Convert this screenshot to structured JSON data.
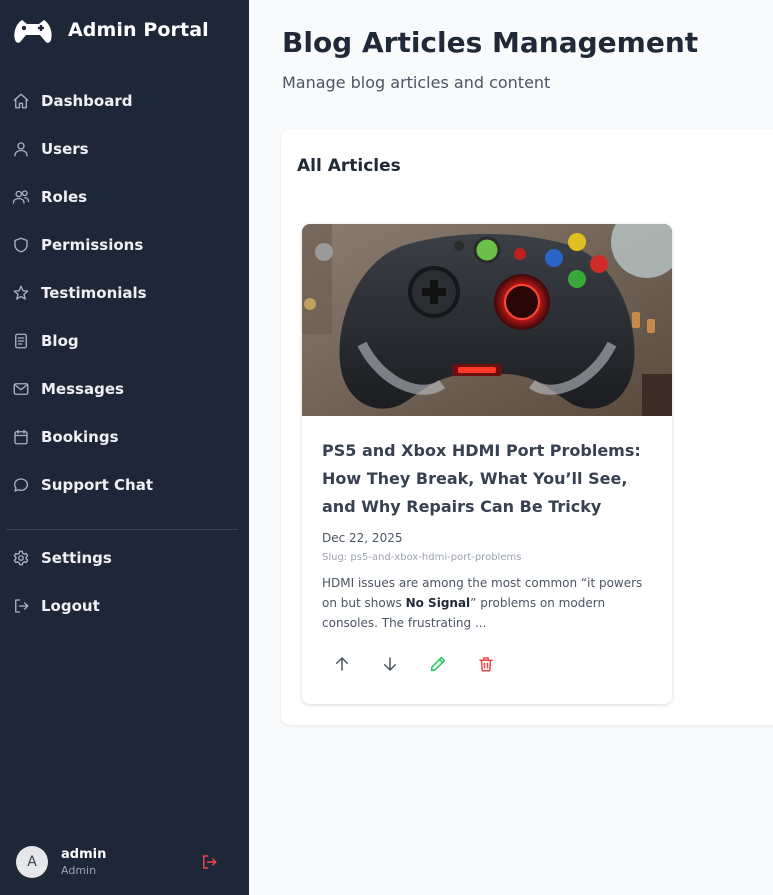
{
  "app": {
    "title": "Admin Portal"
  },
  "colors": {
    "sidebar_bg": "#1e2738",
    "accent_green": "#22c55e",
    "danger": "#ef4444"
  },
  "nav": {
    "items": [
      {
        "label": "Dashboard",
        "icon": "home-icon"
      },
      {
        "label": "Users",
        "icon": "user-icon"
      },
      {
        "label": "Roles",
        "icon": "users-icon"
      },
      {
        "label": "Permissions",
        "icon": "shield-icon"
      },
      {
        "label": "Testimonials",
        "icon": "star-icon"
      },
      {
        "label": "Blog",
        "icon": "document-icon"
      },
      {
        "label": "Messages",
        "icon": "mail-icon"
      },
      {
        "label": "Bookings",
        "icon": "calendar-icon"
      },
      {
        "label": "Support Chat",
        "icon": "chat-icon"
      }
    ],
    "secondary": [
      {
        "label": "Settings",
        "icon": "gear-icon"
      },
      {
        "label": "Logout",
        "icon": "logout-icon"
      }
    ]
  },
  "user": {
    "initial": "A",
    "name": "admin",
    "role": "Admin"
  },
  "page": {
    "title": "Blog Articles Management",
    "subtitle": "Manage blog articles and content"
  },
  "panel": {
    "title": "All Articles"
  },
  "articles": [
    {
      "title": "PS5 and Xbox HDMI Port Problems: How They Break, What You’ll See, and Why Repairs Can Be Tricky",
      "date": "Dec 22, 2025",
      "slug": "Slug: ps5-and-xbox-hdmi-port-problems",
      "excerpt_start": "HDMI issues are among the most common “it powers on but shows ",
      "excerpt_bold": "No Signal",
      "excerpt_end": "” problems on modern consoles. The frustrating ...",
      "actions": [
        "move-up-icon",
        "move-down-icon",
        "edit-icon",
        "delete-icon"
      ]
    }
  ]
}
